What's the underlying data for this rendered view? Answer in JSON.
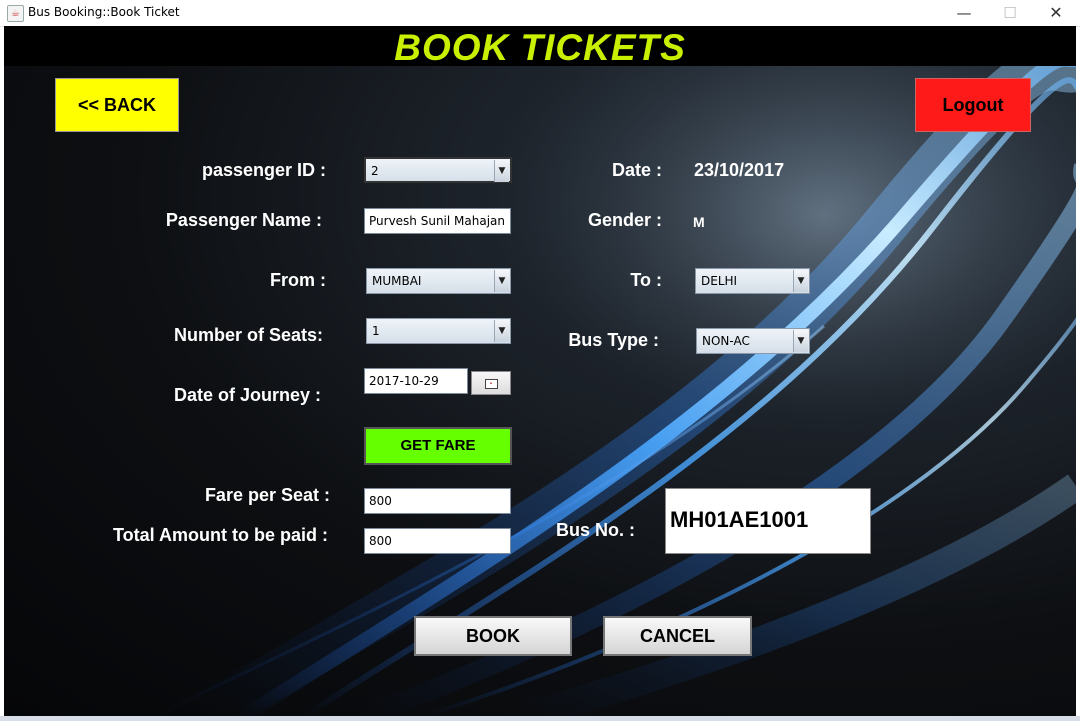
{
  "window": {
    "title": "Bus Booking::Book Ticket",
    "app_icon": "java-cup-icon",
    "controls": {
      "minimize": "—",
      "maximize": "☐",
      "close": "✕"
    }
  },
  "header": {
    "title": "BOOK TICKETS"
  },
  "buttons": {
    "back": "<< BACK",
    "logout": "Logout",
    "get_fare": "GET FARE",
    "book": "BOOK",
    "cancel": "CANCEL"
  },
  "form": {
    "passenger_id": {
      "label": "passenger ID :",
      "value": "2"
    },
    "passenger_name": {
      "label": "Passenger Name :",
      "value": "Purvesh Sunil Mahajan"
    },
    "from": {
      "label": "From :",
      "value": "MUMBAI"
    },
    "number_of_seats": {
      "label": "Number of Seats:",
      "value": "1"
    },
    "date_of_journey": {
      "label": "Date of Journey :",
      "value": "2017-10-29"
    },
    "fare_per_seat": {
      "label": "Fare per Seat :",
      "value": "800"
    },
    "total_amount": {
      "label": "Total Amount to be paid :",
      "value": "800"
    },
    "date": {
      "label": "Date :",
      "value": "23/10/2017"
    },
    "gender": {
      "label": "Gender :",
      "value": "M"
    },
    "to": {
      "label": "To :",
      "value": "DELHI"
    },
    "bus_type": {
      "label": "Bus Type :",
      "value": "NON-AC"
    },
    "bus_no": {
      "label": "Bus No. :",
      "value": "MH01AE1001"
    }
  },
  "colors": {
    "title": "#c8f000",
    "back_button": "#ffff00",
    "logout_button": "#ff1a1a",
    "get_fare_button": "#66ff00"
  }
}
